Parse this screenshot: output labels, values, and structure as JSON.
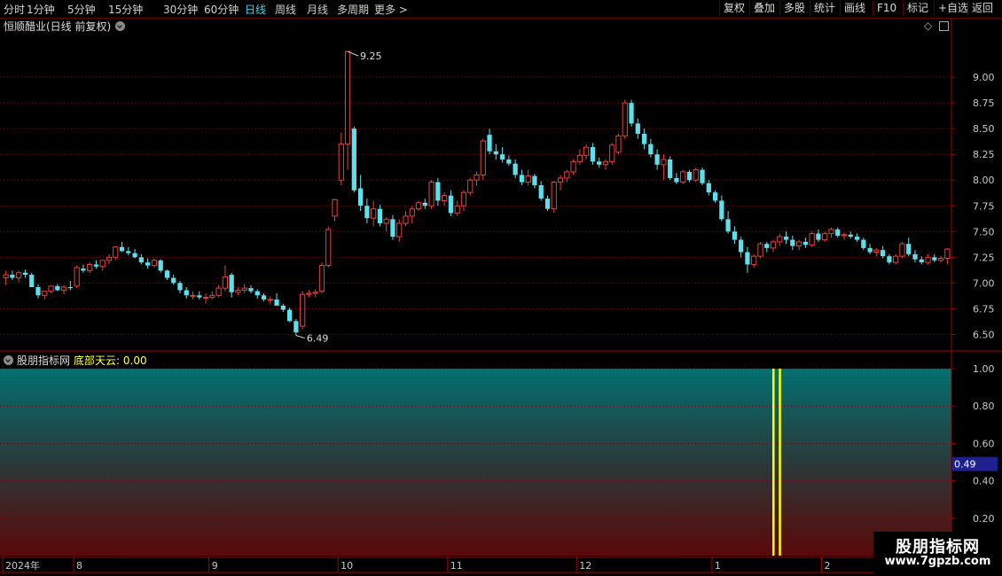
{
  "toolbar": {
    "periods": [
      "分时",
      "1分钟",
      "5分钟",
      "15分钟",
      "30分钟",
      "60分钟",
      "日线",
      "周线",
      "月线",
      "多周期",
      "更多 >"
    ],
    "active_period": "日线",
    "right_buttons": [
      "复权",
      "叠加",
      "多股",
      "统计",
      "画线",
      "F10",
      "标记",
      "+自选",
      "返回"
    ]
  },
  "main_chart": {
    "title": "恒顺醋业(日线 前复权)",
    "max_label": "9.25",
    "min_label": "6.49"
  },
  "indicator": {
    "source": "股朋指标网",
    "label": "底部天云: 0.00",
    "current_value": "0.49"
  },
  "logo": {
    "name": "股朋指标网",
    "url": "www.7gpzb.com"
  },
  "colors": {
    "up": "#e8403a",
    "down": "#5ce0ec",
    "grid": "#7a0000",
    "axis": "#a00000",
    "signal": "#ffff00",
    "highlight": "#1e2090"
  },
  "chart_data": {
    "type": "candlestick",
    "y_ticks": [
      9.0,
      8.75,
      8.5,
      8.25,
      8.0,
      7.75,
      7.5,
      7.25,
      7.0,
      6.75,
      6.5
    ],
    "y_tick_labels": [
      "9.00",
      "8.75",
      "8.50",
      "8.25",
      "8.00",
      "7.75",
      "7.50",
      "7.25",
      "7.00",
      "6.75",
      "6.50"
    ],
    "ylim": [
      6.34,
      9.44
    ],
    "ohlc": [
      [
        7.05,
        7.12,
        6.98,
        7.08
      ],
      [
        7.08,
        7.12,
        7.03,
        7.05
      ],
      [
        7.05,
        7.12,
        7.01,
        7.1
      ],
      [
        7.1,
        7.13,
        7.05,
        7.08
      ],
      [
        7.08,
        7.1,
        6.99,
        6.96
      ],
      [
        6.96,
        6.99,
        6.85,
        6.88
      ],
      [
        6.88,
        6.92,
        6.84,
        6.92
      ],
      [
        6.92,
        6.97,
        6.9,
        6.97
      ],
      [
        6.97,
        6.99,
        6.92,
        6.93
      ],
      [
        6.93,
        6.98,
        6.89,
        6.96
      ],
      [
        6.96,
        7.02,
        6.93,
        6.95
      ],
      [
        6.97,
        7.17,
        6.95,
        7.15
      ],
      [
        7.14,
        7.18,
        7.1,
        7.12
      ],
      [
        7.12,
        7.2,
        7.1,
        7.18
      ],
      [
        7.18,
        7.22,
        7.14,
        7.16
      ],
      [
        7.16,
        7.2,
        7.12,
        7.22
      ],
      [
        7.22,
        7.28,
        7.18,
        7.25
      ],
      [
        7.25,
        7.36,
        7.22,
        7.35
      ],
      [
        7.35,
        7.4,
        7.3,
        7.31
      ],
      [
        7.31,
        7.35,
        7.27,
        7.29
      ],
      [
        7.29,
        7.33,
        7.24,
        7.25
      ],
      [
        7.25,
        7.28,
        7.18,
        7.2
      ],
      [
        7.2,
        7.24,
        7.14,
        7.17
      ],
      [
        7.17,
        7.24,
        7.15,
        7.22
      ],
      [
        7.22,
        7.23,
        7.1,
        7.12
      ],
      [
        7.12,
        7.13,
        7.03,
        7.05
      ],
      [
        7.05,
        7.08,
        6.98,
        7.0
      ],
      [
        7.0,
        7.02,
        6.9,
        6.93
      ],
      [
        6.93,
        6.96,
        6.85,
        6.88
      ],
      [
        6.88,
        6.92,
        6.84,
        6.88
      ],
      [
        6.88,
        6.92,
        6.84,
        6.86
      ],
      [
        6.86,
        6.9,
        6.8,
        6.86
      ],
      [
        6.86,
        6.92,
        6.84,
        6.88
      ],
      [
        6.88,
        6.98,
        6.86,
        6.95
      ],
      [
        6.95,
        7.17,
        6.92,
        7.06
      ],
      [
        7.08,
        7.1,
        6.86,
        6.91
      ],
      [
        6.91,
        6.96,
        6.88,
        6.93
      ],
      [
        6.93,
        6.99,
        6.9,
        6.95
      ],
      [
        6.95,
        6.98,
        6.9,
        6.92
      ],
      [
        6.92,
        6.94,
        6.85,
        6.88
      ],
      [
        6.88,
        6.9,
        6.82,
        6.84
      ],
      [
        6.84,
        6.87,
        6.79,
        6.84
      ],
      [
        6.84,
        6.9,
        6.8,
        6.78
      ],
      [
        6.78,
        6.8,
        6.72,
        6.74
      ],
      [
        6.74,
        6.76,
        6.62,
        6.63
      ],
      [
        6.63,
        6.65,
        6.49,
        6.52
      ],
      [
        6.58,
        6.92,
        6.55,
        6.89
      ],
      [
        6.89,
        6.93,
        6.86,
        6.9
      ],
      [
        6.9,
        6.94,
        6.86,
        6.91
      ],
      [
        6.92,
        7.2,
        6.9,
        7.17
      ],
      [
        7.17,
        7.55,
        7.15,
        7.52
      ],
      [
        7.65,
        7.82,
        7.6,
        7.81
      ],
      [
        8.0,
        8.46,
        7.95,
        8.35
      ],
      [
        8.35,
        9.25,
        8.1,
        9.25
      ],
      [
        8.5,
        8.52,
        7.88,
        7.9
      ],
      [
        7.92,
        8.05,
        7.7,
        7.75
      ],
      [
        7.75,
        7.82,
        7.58,
        7.63
      ],
      [
        7.63,
        7.8,
        7.55,
        7.72
      ],
      [
        7.72,
        7.76,
        7.55,
        7.58
      ],
      [
        7.58,
        7.64,
        7.5,
        7.62
      ],
      [
        7.62,
        7.66,
        7.42,
        7.45
      ],
      [
        7.45,
        7.62,
        7.4,
        7.58
      ],
      [
        7.58,
        7.7,
        7.55,
        7.65
      ],
      [
        7.65,
        7.75,
        7.58,
        7.72
      ],
      [
        7.72,
        7.8,
        7.7,
        7.78
      ],
      [
        7.78,
        7.82,
        7.72,
        7.75
      ],
      [
        7.75,
        8.0,
        7.72,
        7.98
      ],
      [
        7.98,
        8.02,
        7.75,
        7.8
      ],
      [
        7.8,
        7.88,
        7.75,
        7.85
      ],
      [
        7.85,
        7.9,
        7.65,
        7.68
      ],
      [
        7.68,
        7.8,
        7.65,
        7.75
      ],
      [
        7.75,
        7.9,
        7.7,
        7.88
      ],
      [
        7.88,
        8.02,
        7.85,
        8.0
      ],
      [
        8.0,
        8.08,
        7.95,
        8.05
      ],
      [
        8.05,
        8.4,
        8.0,
        8.38
      ],
      [
        8.44,
        8.5,
        8.25,
        8.28
      ],
      [
        8.28,
        8.35,
        8.2,
        8.25
      ],
      [
        8.25,
        8.32,
        8.17,
        8.2
      ],
      [
        8.2,
        8.24,
        8.14,
        8.16
      ],
      [
        8.16,
        8.2,
        8.02,
        8.05
      ],
      [
        8.05,
        8.1,
        7.95,
        7.98
      ],
      [
        7.98,
        8.1,
        7.95,
        8.04
      ],
      [
        8.04,
        8.06,
        7.92,
        7.95
      ],
      [
        7.95,
        7.99,
        7.8,
        7.82
      ],
      [
        7.82,
        7.85,
        7.7,
        7.72
      ],
      [
        7.72,
        7.99,
        7.68,
        7.98
      ],
      [
        7.98,
        8.05,
        7.9,
        8.02
      ],
      [
        8.02,
        8.1,
        7.98,
        8.08
      ],
      [
        8.08,
        8.2,
        8.05,
        8.18
      ],
      [
        8.18,
        8.3,
        8.15,
        8.24
      ],
      [
        8.24,
        8.35,
        8.2,
        8.32
      ],
      [
        8.32,
        8.36,
        8.15,
        8.18
      ],
      [
        8.18,
        8.22,
        8.12,
        8.15
      ],
      [
        8.15,
        8.2,
        8.1,
        8.18
      ],
      [
        8.18,
        8.36,
        8.15,
        8.34
      ],
      [
        8.27,
        8.45,
        8.25,
        8.43
      ],
      [
        8.43,
        8.78,
        8.4,
        8.75
      ],
      [
        8.75,
        8.78,
        8.52,
        8.55
      ],
      [
        8.55,
        8.6,
        8.4,
        8.45
      ],
      [
        8.45,
        8.5,
        8.3,
        8.35
      ],
      [
        8.35,
        8.4,
        8.22,
        8.25
      ],
      [
        8.25,
        8.3,
        8.1,
        8.15
      ],
      [
        8.15,
        8.25,
        8.0,
        8.2
      ],
      [
        8.2,
        8.23,
        8.0,
        8.02
      ],
      [
        8.02,
        8.07,
        7.96,
        7.98
      ],
      [
        7.98,
        8.1,
        7.96,
        8.08
      ],
      [
        8.08,
        8.1,
        7.98,
        8.0
      ],
      [
        8.0,
        8.12,
        7.98,
        8.1
      ],
      [
        8.1,
        8.12,
        7.95,
        7.97
      ],
      [
        7.97,
        8.0,
        7.85,
        7.88
      ],
      [
        7.88,
        7.9,
        7.78,
        7.8
      ],
      [
        7.8,
        7.85,
        7.6,
        7.62
      ],
      [
        7.62,
        7.7,
        7.48,
        7.5
      ],
      [
        7.5,
        7.55,
        7.38,
        7.42
      ],
      [
        7.42,
        7.45,
        7.25,
        7.3
      ],
      [
        7.3,
        7.35,
        7.1,
        7.18
      ],
      [
        7.18,
        7.28,
        7.15,
        7.26
      ],
      [
        7.26,
        7.4,
        7.24,
        7.38
      ],
      [
        7.38,
        7.4,
        7.3,
        7.34
      ],
      [
        7.34,
        7.42,
        7.3,
        7.4
      ],
      [
        7.4,
        7.48,
        7.36,
        7.45
      ],
      [
        7.45,
        7.5,
        7.38,
        7.42
      ],
      [
        7.42,
        7.46,
        7.32,
        7.36
      ],
      [
        7.36,
        7.42,
        7.32,
        7.4
      ],
      [
        7.4,
        7.44,
        7.34,
        7.37
      ],
      [
        7.37,
        7.5,
        7.35,
        7.48
      ],
      [
        7.48,
        7.52,
        7.4,
        7.42
      ],
      [
        7.42,
        7.5,
        7.4,
        7.48
      ],
      [
        7.48,
        7.54,
        7.44,
        7.52
      ],
      [
        7.52,
        7.54,
        7.44,
        7.46
      ],
      [
        7.46,
        7.49,
        7.42,
        7.47
      ],
      [
        7.47,
        7.5,
        7.43,
        7.45
      ],
      [
        7.45,
        7.48,
        7.4,
        7.42
      ],
      [
        7.42,
        7.44,
        7.32,
        7.34
      ],
      [
        7.34,
        7.38,
        7.28,
        7.3
      ],
      [
        7.3,
        7.34,
        7.26,
        7.32
      ],
      [
        7.32,
        7.36,
        7.24,
        7.26
      ],
      [
        7.26,
        7.28,
        7.18,
        7.2
      ],
      [
        7.2,
        7.28,
        7.18,
        7.26
      ],
      [
        7.26,
        7.4,
        7.24,
        7.38
      ],
      [
        7.38,
        7.44,
        7.26,
        7.28
      ],
      [
        7.28,
        7.32,
        7.2,
        7.23
      ],
      [
        7.23,
        7.26,
        7.18,
        7.2
      ],
      [
        7.2,
        7.28,
        7.18,
        7.25
      ],
      [
        7.25,
        7.28,
        7.2,
        7.22
      ],
      [
        7.22,
        7.26,
        7.2,
        7.24
      ],
      [
        7.24,
        7.34,
        7.18,
        7.33
      ]
    ],
    "sub_y_ticks": [
      1.0,
      0.8,
      0.6,
      0.4,
      0.2
    ],
    "sub_y_tick_labels": [
      "1.00",
      "0.80",
      "0.60",
      "0.40",
      "0.20"
    ],
    "sub_ylim": [
      0.0,
      1.0
    ],
    "signal_bars": [
      {
        "bar_index": 119,
        "value": 1.0
      },
      {
        "bar_index": 120,
        "value": 1.0
      }
    ],
    "x_labels": [
      "2024年",
      "8",
      "9",
      "10",
      "11",
      "12",
      "1",
      "2"
    ],
    "x_label_bar_index": [
      0,
      11,
      32,
      52,
      69,
      89,
      110,
      127
    ]
  }
}
